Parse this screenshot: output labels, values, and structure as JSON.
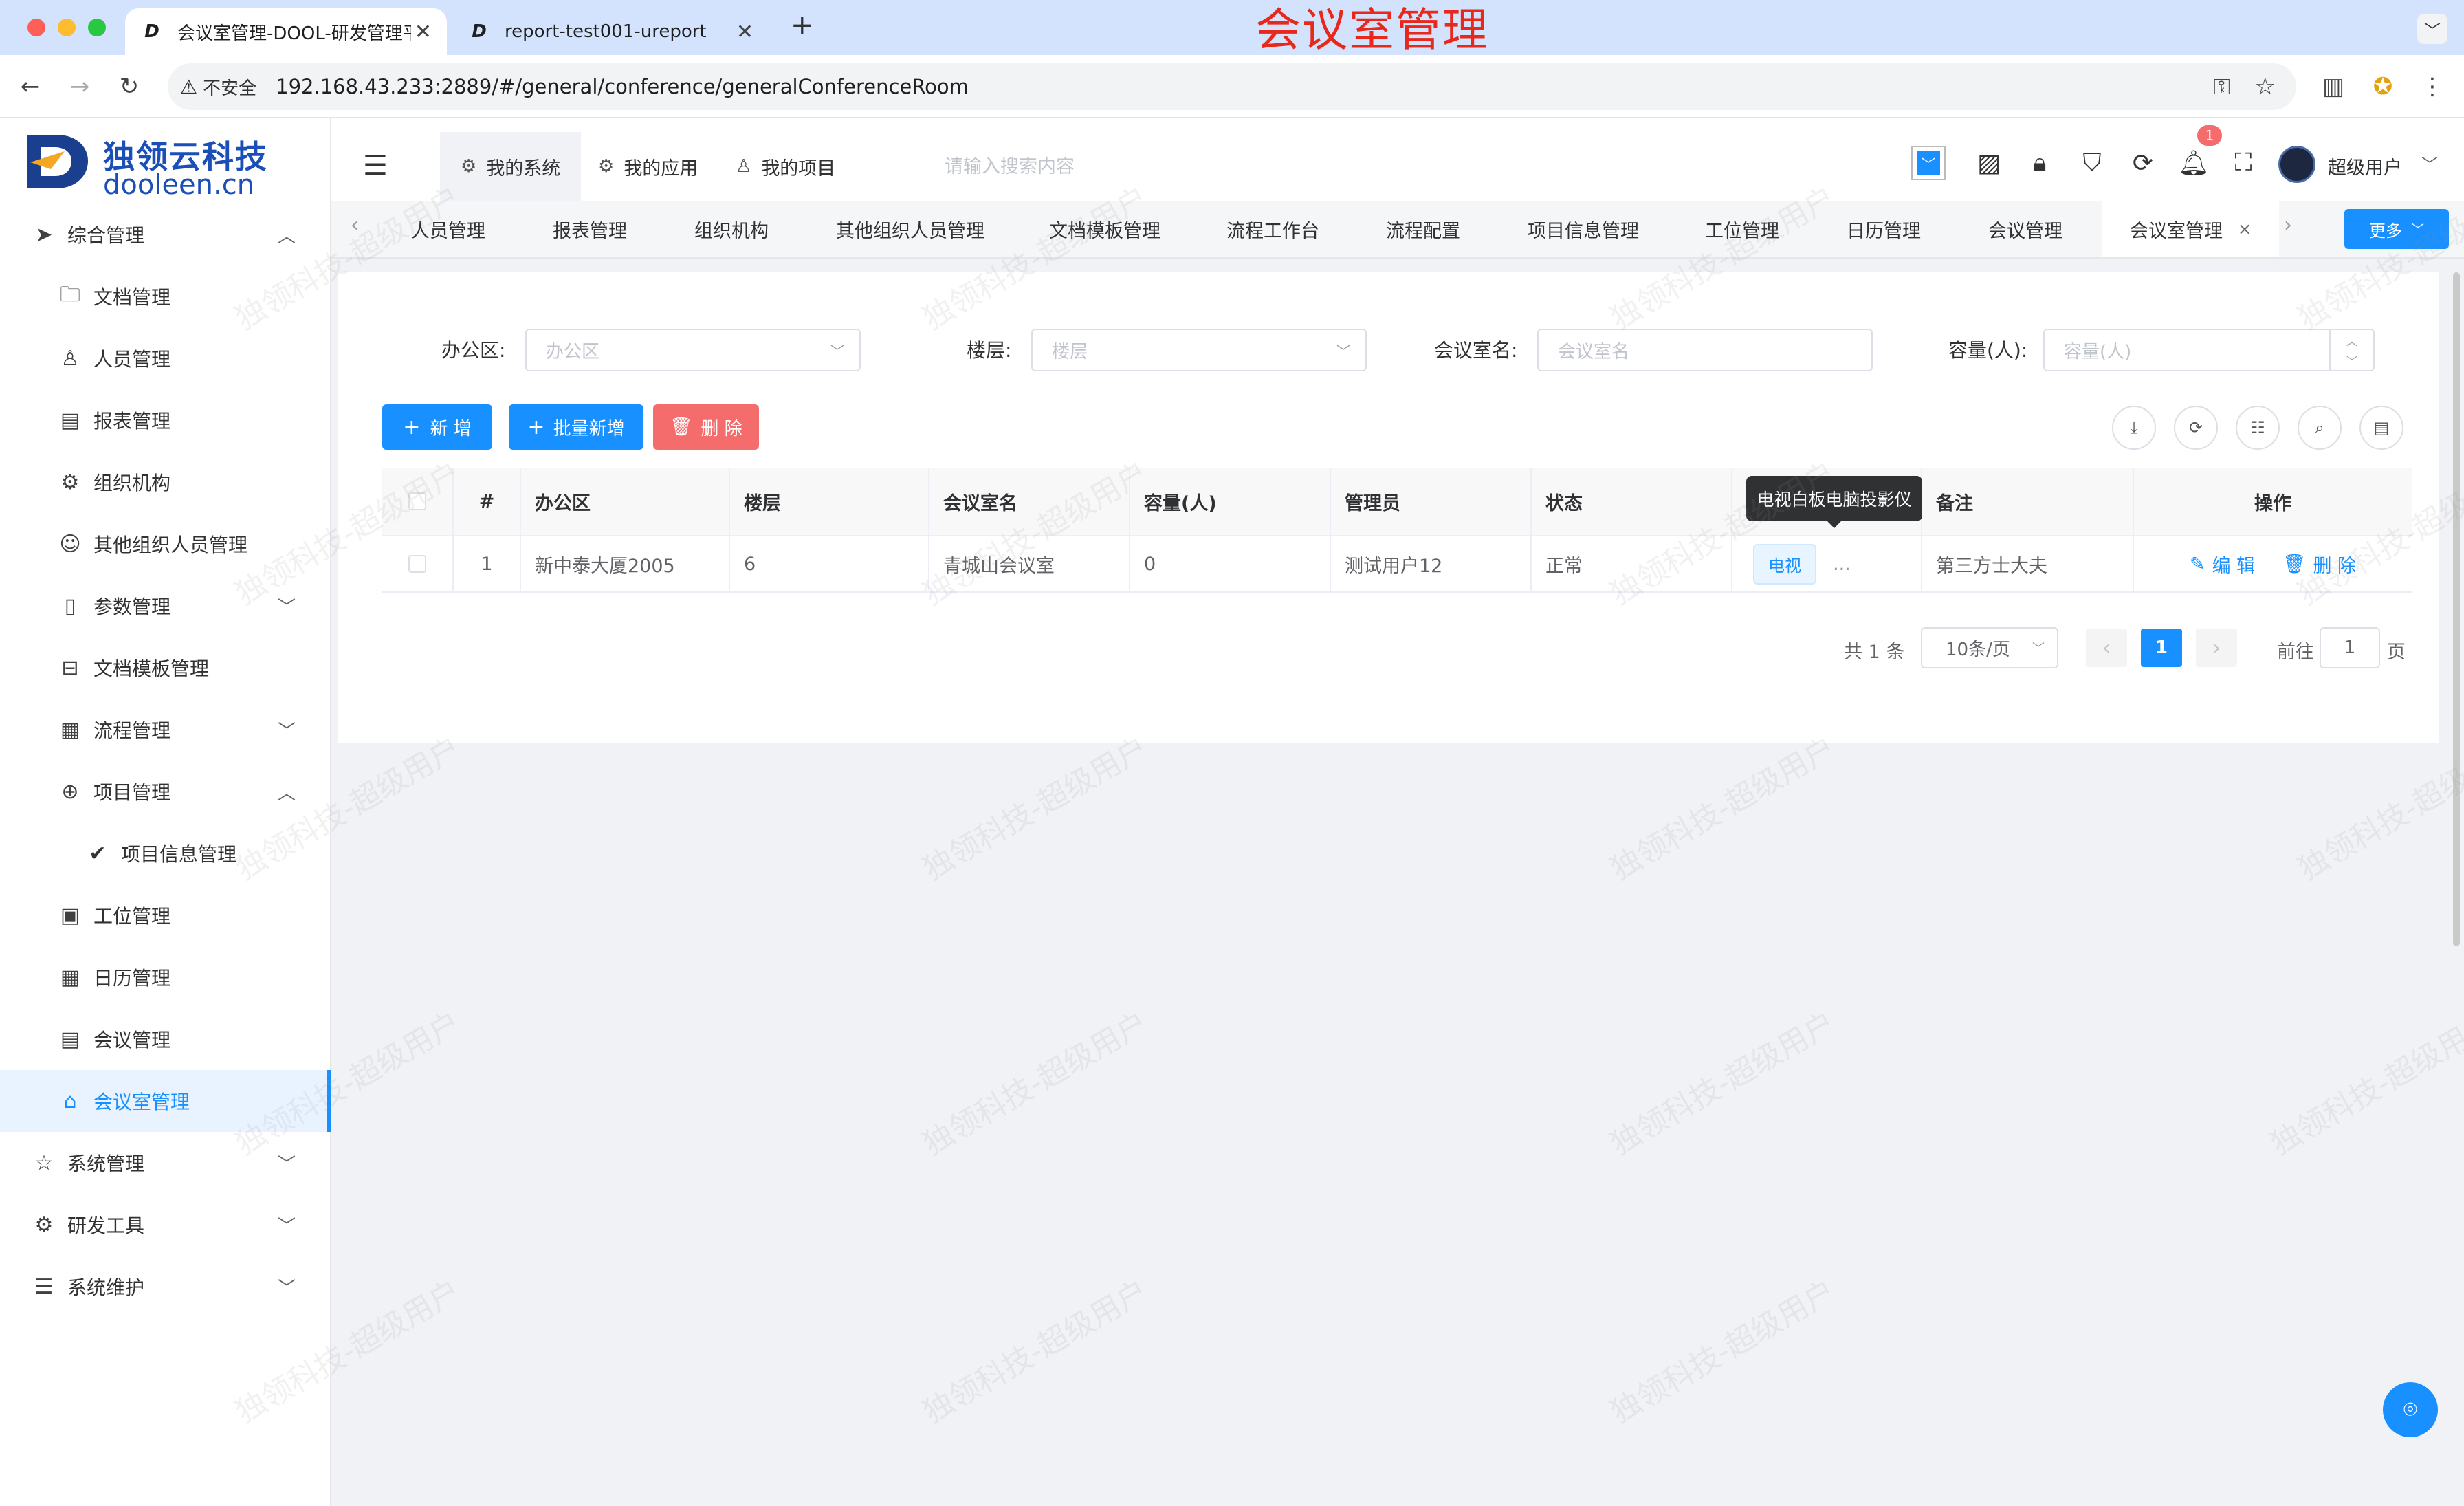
{
  "browser": {
    "tabs": [
      {
        "title": "会议室管理-DOOL-研发管理平",
        "close": "✕"
      },
      {
        "title": "report-test001-ureport",
        "close": "✕"
      }
    ],
    "new_tab": "+",
    "security": "不安全",
    "url": "192.168.43.233:2889/#/general/conference/generalConferenceRoom",
    "annotation": "会议室管理"
  },
  "brand": {
    "cn": "独领云科技",
    "en": "dooleen.cn"
  },
  "sidebar": {
    "items": [
      {
        "label": "综合管理",
        "icon": "paper-plane-icon",
        "chev": "︿"
      },
      {
        "label": "文档管理",
        "icon": "folder-icon"
      },
      {
        "label": "人员管理",
        "icon": "user-icon"
      },
      {
        "label": "报表管理",
        "icon": "report-icon"
      },
      {
        "label": "组织机构",
        "icon": "gear-icon"
      },
      {
        "label": "其他组织人员管理",
        "icon": "smile-icon"
      },
      {
        "label": "参数管理",
        "icon": "book-icon",
        "chev": "﹀"
      },
      {
        "label": "文档模板管理",
        "icon": "template-icon"
      },
      {
        "label": "流程管理",
        "icon": "calendar-grid-icon",
        "chev": "﹀"
      },
      {
        "label": "项目管理",
        "icon": "plus-circle-icon",
        "chev": "︿"
      },
      {
        "label": "项目信息管理",
        "icon": "check-circle-icon"
      },
      {
        "label": "工位管理",
        "icon": "clipboard-icon"
      },
      {
        "label": "日历管理",
        "icon": "calendar-icon"
      },
      {
        "label": "会议管理",
        "icon": "doc-icon"
      },
      {
        "label": "会议室管理",
        "icon": "home-icon"
      },
      {
        "label": "系统管理",
        "icon": "star-icon",
        "chev": "﹀"
      },
      {
        "label": "研发工具",
        "icon": "settings-icon",
        "chev": "﹀"
      },
      {
        "label": "系统维护",
        "icon": "sliders-icon",
        "chev": "﹀"
      }
    ]
  },
  "header": {
    "nav": [
      {
        "label": "我的系统",
        "icon": "gear-icon"
      },
      {
        "label": "我的应用",
        "icon": "gear-outline-icon"
      },
      {
        "label": "我的项目",
        "icon": "user-icon"
      }
    ],
    "search_placeholder": "请输入搜索内容",
    "notification_count": "1",
    "user": "超级用户"
  },
  "tags": {
    "items": [
      "人员管理",
      "报表管理",
      "组织机构",
      "其他组织人员管理",
      "文档模板管理",
      "流程工作台",
      "流程配置",
      "项目信息管理",
      "工位管理",
      "日历管理",
      "会议管理",
      "会议室管理"
    ],
    "close": "×",
    "more": "更多"
  },
  "filters": {
    "office_label": "办公区:",
    "office_placeholder": "办公区",
    "floor_label": "楼层:",
    "floor_placeholder": "楼层",
    "room_label": "会议室名:",
    "room_placeholder": "会议室名",
    "capacity_label": "容量(人):",
    "capacity_placeholder": "容量(人)"
  },
  "actions": {
    "add": "新 增",
    "batch_add": "批量新增",
    "delete": "删 除"
  },
  "table": {
    "columns": [
      "#",
      "办公区",
      "楼层",
      "会议室名",
      "容量(人)",
      "管理员",
      "状态",
      "",
      "备注",
      "操作"
    ],
    "rows": [
      {
        "index": "1",
        "office": "新中泰大厦2005",
        "floor": "6",
        "room": "青城山会议室",
        "capacity": "0",
        "admin": "测试用户12",
        "status": "正常",
        "equipment_tag": "电视",
        "ellipsis": "...",
        "remark": "第三方士大夫",
        "edit": "编 辑",
        "delete": "删 除"
      }
    ],
    "tooltip": "电视白板电脑投影仪"
  },
  "pagination": {
    "total": "共 1 条",
    "page_size": "10条/页",
    "current": "1",
    "goto_label": "前往",
    "goto_value": "1",
    "page_suffix": "页"
  },
  "watermark": "独领科技-超级用户",
  "colors": {
    "primary": "#1890ff",
    "danger": "#f56c6c",
    "annotation": "#e8281b"
  }
}
